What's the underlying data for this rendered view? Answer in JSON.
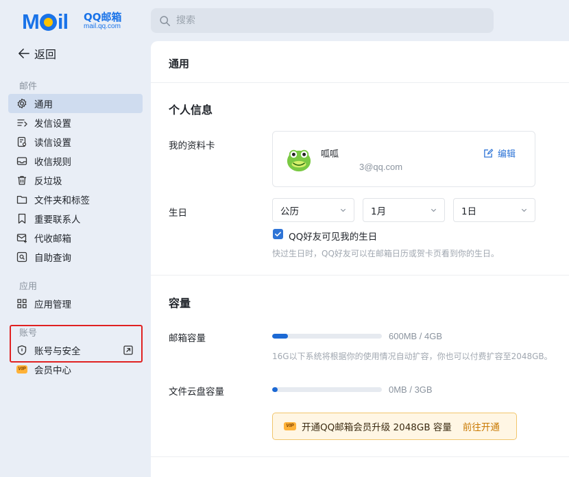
{
  "logo": {
    "wordmark": "MOIL",
    "brand_cn": "QQ邮箱",
    "url": "mail.qq.com"
  },
  "search": {
    "placeholder": "搜索",
    "value": ""
  },
  "sidebar": {
    "back_label": "返回",
    "mail_section": "邮件",
    "mail_items": [
      {
        "label": "通用",
        "icon": "gear-icon",
        "active": true
      },
      {
        "label": "发信设置",
        "icon": "send-settings-icon"
      },
      {
        "label": "读信设置",
        "icon": "read-settings-icon"
      },
      {
        "label": "收信规则",
        "icon": "inbox-rules-icon"
      },
      {
        "label": "反垃圾",
        "icon": "trash-icon"
      },
      {
        "label": "文件夹和标签",
        "icon": "folder-icon"
      },
      {
        "label": "重要联系人",
        "icon": "bookmark-icon"
      },
      {
        "label": "代收邮箱",
        "icon": "mailbox-collect-icon"
      },
      {
        "label": "自助查询",
        "icon": "self-query-icon"
      }
    ],
    "app_section": "应用",
    "app_items": [
      {
        "label": "应用管理",
        "icon": "grid-icon"
      }
    ],
    "account_section": "账号",
    "account_items": [
      {
        "label": "账号与安全",
        "icon": "shield-icon"
      },
      {
        "label": "会员中心",
        "icon": "vip-icon",
        "badge": "VIP"
      }
    ]
  },
  "main": {
    "title": "通用",
    "personal_info": {
      "heading": "个人信息",
      "profile_label": "我的资料卡",
      "nickname": "呱呱",
      "email": "3@qq.com",
      "edit_label": "编辑"
    },
    "birthday": {
      "label": "生日",
      "calendar": "公历",
      "month": "1月",
      "day": "1日",
      "visible_checked": true,
      "visible_label": "QQ好友可见我的生日",
      "hint": "快过生日时，QQ好友可以在邮箱日历或贺卡页看到你的生日。"
    },
    "capacity": {
      "heading": "容量",
      "mailbox_label": "邮箱容量",
      "mailbox_value": "600MB / 4GB",
      "mailbox_fraction": 0.146,
      "mailbox_hint": "16G以下系统将根据你的使用情况自动扩容，你也可以付费扩容至2048GB。",
      "disk_label": "文件云盘容量",
      "disk_value": "0MB / 3GB",
      "disk_fraction": 0.05,
      "promo_text": "开通QQ邮箱会员升级 2048GB 容量",
      "promo_link": "前往开通",
      "promo_badge": "VIP"
    }
  },
  "colors": {
    "accent": "#1a73e8",
    "highlight": "#e02020",
    "link": "#2e74d6",
    "promo": "#c87800"
  }
}
